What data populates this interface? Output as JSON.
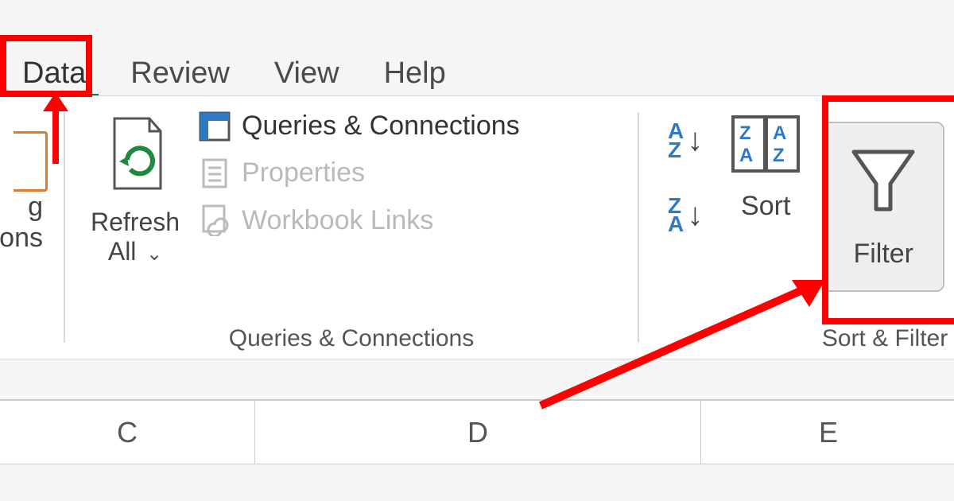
{
  "tabs": {
    "data": "Data",
    "review": "Review",
    "view": "View",
    "help": "Help"
  },
  "leftcut": {
    "line1": "g",
    "line2": "ons"
  },
  "refresh": {
    "line1": "Refresh",
    "line2": "All"
  },
  "queries": {
    "qc": "Queries & Connections",
    "props": "Properties",
    "links": "Workbook Links",
    "group_label": "Queries & Connections"
  },
  "sort": {
    "button": "Sort",
    "group_label": "Sort & Filter"
  },
  "filter": {
    "label": "Filter"
  },
  "columns": {
    "c": "C",
    "d": "D",
    "e": "E"
  }
}
